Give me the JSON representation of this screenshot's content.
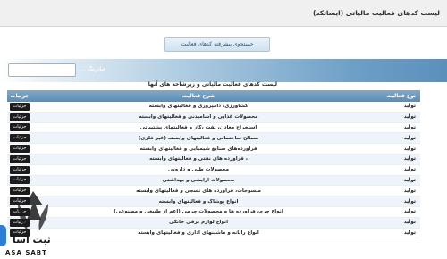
{
  "page": {
    "title": "لیست کدهای فعالیت مالیاتی (ایساتکد)",
    "advanced_search_label": "جستجوی پیشرفته کدهای فعالیت",
    "filter_label": "فیلترینگ ..."
  },
  "grid": {
    "caption": "لیست کدهای فعالیت مالیاتی و زیرشاخه های آنها",
    "headers": {
      "details": "جزئیات",
      "description": "شرح فعالیت",
      "type": "نوع فعالیت"
    },
    "details_label": "جزئیات",
    "rows": [
      {
        "type": "تولید",
        "description": "کشاورزی، دامپروری و فعالیتهای وابسته"
      },
      {
        "type": "تولید",
        "description": "محصولات غذایی و آشامیدنی و فعالیتهای وابسته"
      },
      {
        "type": "تولید",
        "description": "استخراج معادن، نفت ،گاز و فعالیتهای پشتیبانی"
      },
      {
        "type": "تولید",
        "description": "مصالح ساختمانی و فعالیتهای وابسته (غیر فلزی)"
      },
      {
        "type": "تولید",
        "description": "فرآورده‌های صنایع شیمیایی و فعالیتهای وابسته"
      },
      {
        "type": "تولید",
        "description": "، فرآورده های نفتی و فعالیتهای وابسته"
      },
      {
        "type": "تولید",
        "description": "محصولات طبی و دارویی"
      },
      {
        "type": "تولید",
        "description": "محصولات آرایشی و بهداشتی"
      },
      {
        "type": "تولید",
        "description": "منسوجات، فرآورده های نسجی و فعالیتهای وابسته"
      },
      {
        "type": "تولید",
        "description": "انواع پوشاک و فعالیتهای وابسته"
      },
      {
        "type": "تولید",
        "description": "انواع چرم، فرآورده ها و محصولات چرمی (اعم از طبیعی و مصنوعی)"
      },
      {
        "type": "تولید",
        "description": "انواع لوازم برقی خانگی"
      },
      {
        "type": "تولید",
        "description": "انواع رایانه و ماشینهای اداری و فعالیتهای وابسته"
      }
    ]
  },
  "logo": {
    "text": "ثبت آسا",
    "sub": "ASA SABT"
  },
  "colors": {
    "header_blue": "#5b8db6",
    "details_button": "#1c1c1c"
  }
}
